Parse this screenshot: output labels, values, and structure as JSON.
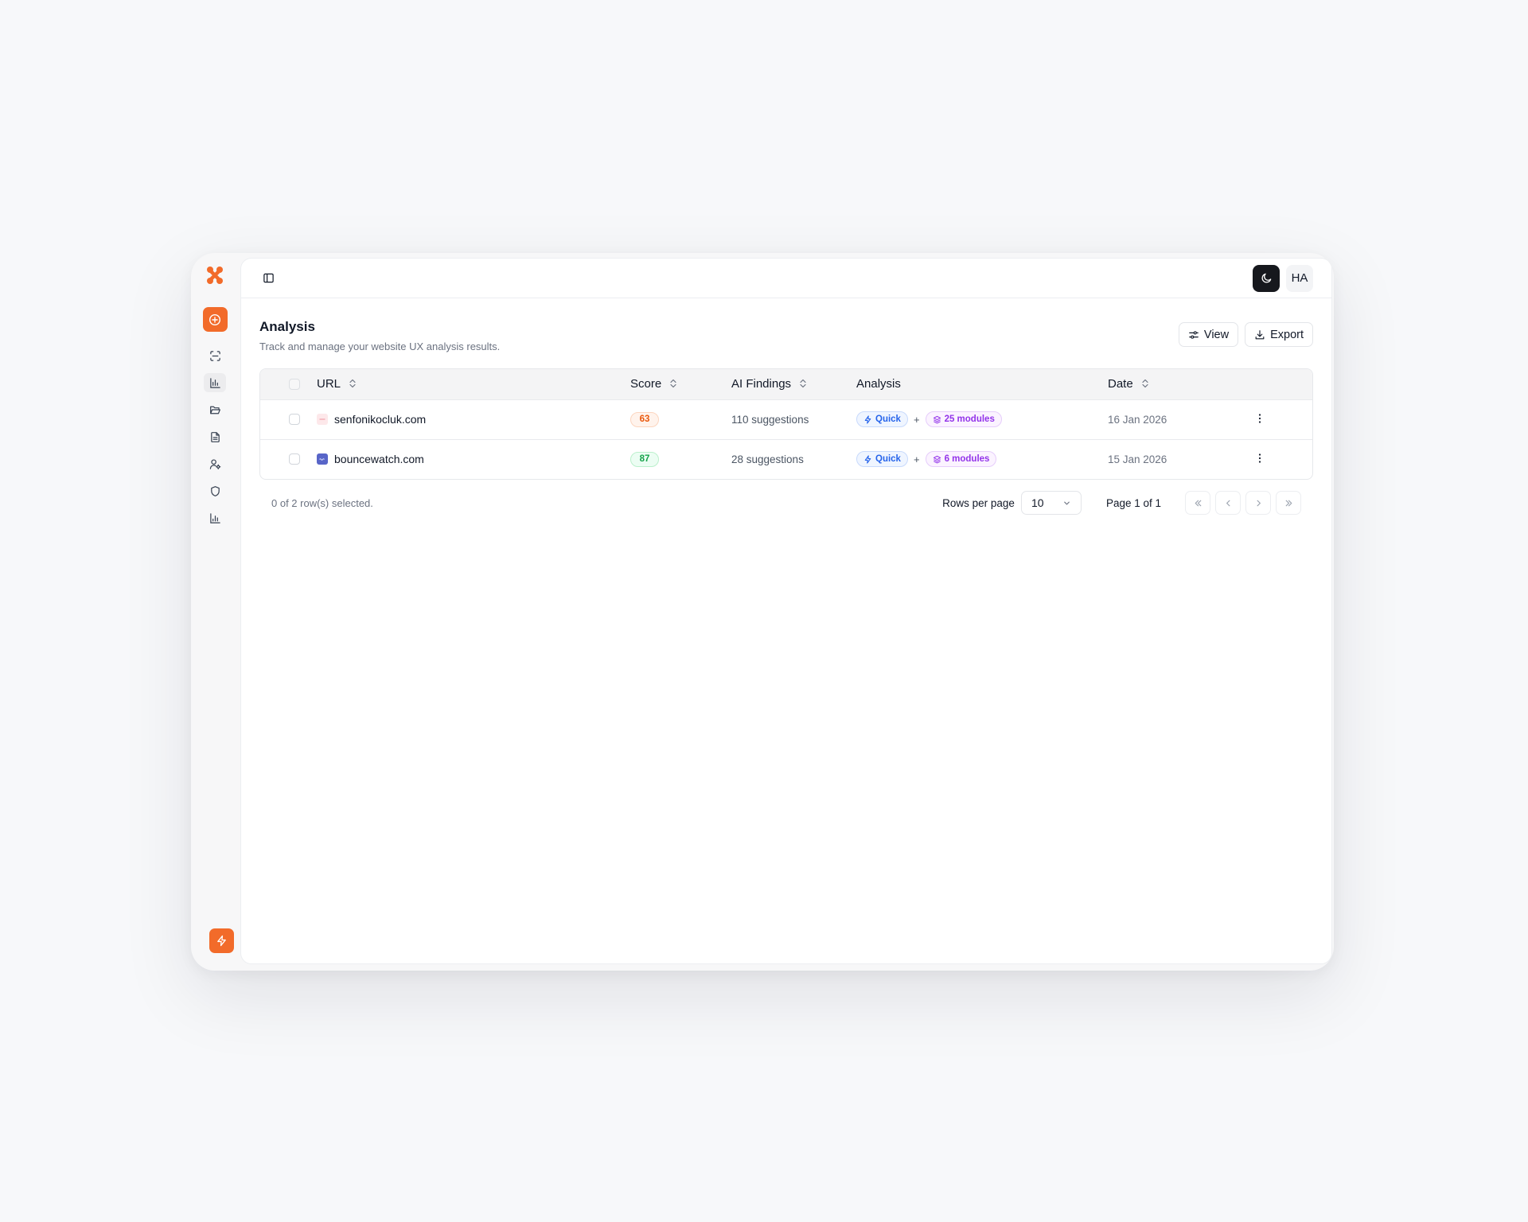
{
  "header": {
    "avatar_initials": "HA"
  },
  "page": {
    "title": "Analysis",
    "subtitle": "Track and manage your website UX analysis results."
  },
  "toolbar": {
    "view_label": "View",
    "export_label": "Export"
  },
  "table": {
    "columns": {
      "url": "URL",
      "score": "Score",
      "findings": "AI Findings",
      "analysis": "Analysis",
      "date": "Date"
    },
    "rows": [
      {
        "url": "senfonikocluk.com",
        "favicon": "favicon-pink",
        "score": "63",
        "score_level": "orange",
        "findings": "110 suggestions",
        "analysis_type": "Quick",
        "plus": "+",
        "modules": "25 modules",
        "date": "16 Jan 2026"
      },
      {
        "url": "bouncewatch.com",
        "favicon": "favicon-blue",
        "score": "87",
        "score_level": "green",
        "findings": "28 suggestions",
        "analysis_type": "Quick",
        "plus": "+",
        "modules": "6 modules",
        "date": "15 Jan 2026"
      }
    ]
  },
  "footer": {
    "selection": "0 of 2 row(s) selected.",
    "rows_per_page_label": "Rows per page",
    "rows_per_page_value": "10",
    "page_info": "Page 1 of 1"
  },
  "colors": {
    "accent": "#f26b2a",
    "score_orange": "#ea580c",
    "score_green": "#16a34a",
    "chip_quick": "#2563eb",
    "chip_modules": "#9333ea"
  },
  "icons": {
    "rail": [
      "scan-icon",
      "bar-chart-icon",
      "folder-icon",
      "file-text-icon",
      "user-cog-icon",
      "shield-icon",
      "chart-axis-icon"
    ]
  }
}
